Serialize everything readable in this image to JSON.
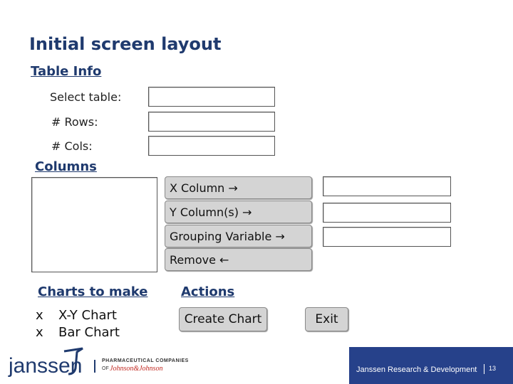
{
  "page": {
    "title": "Initial screen layout"
  },
  "table_info": {
    "heading": "Table Info",
    "select_table_label": "Select table:",
    "rows_label": "# Rows:",
    "cols_label": "# Cols:"
  },
  "columns": {
    "heading": "Columns",
    "x_column_button": "X Column →",
    "y_column_button": "Y Column(s) →",
    "grouping_button": "Grouping Variable →",
    "remove_button": "Remove ←"
  },
  "charts": {
    "heading": "Charts to make",
    "items": [
      {
        "mark": "x",
        "label": "X-Y Chart"
      },
      {
        "mark": "x",
        "label": "Bar Chart"
      }
    ]
  },
  "actions": {
    "heading": "Actions",
    "create_chart_button": "Create Chart",
    "exit_button": "Exit"
  },
  "footer": {
    "logo": "janssen",
    "pharma_line1": "PHARMACEUTICAL COMPANIES",
    "pharma_line2": "OF",
    "pharma_brand": "Johnson&Johnson",
    "company_text": "Janssen Research & Development",
    "page_number": "13",
    "bar_color": "#26418a"
  },
  "colors": {
    "heading": "#1f3a6e",
    "button_bg": "#d4d4d4"
  }
}
